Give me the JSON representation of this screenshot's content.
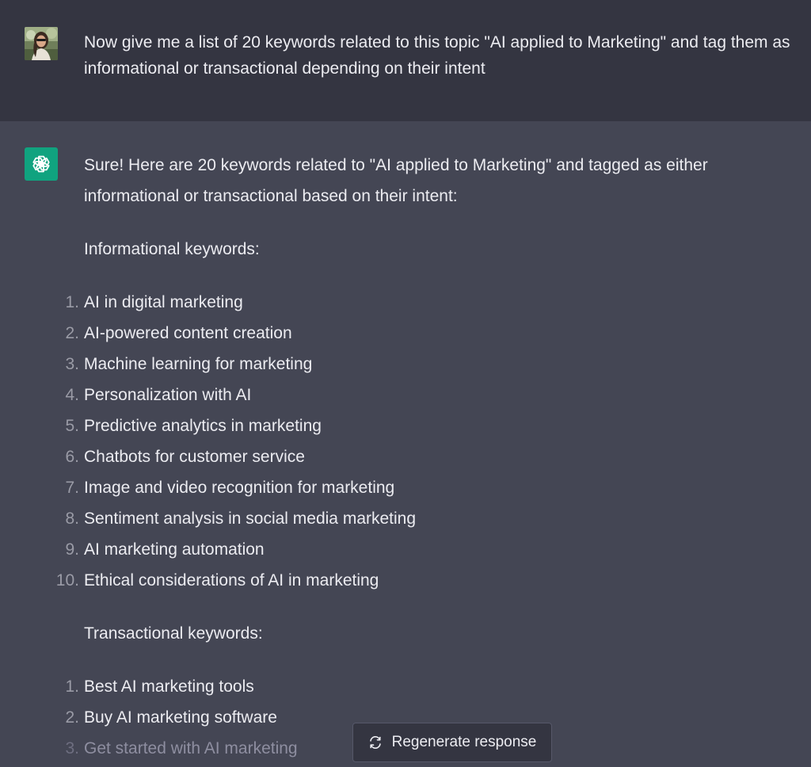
{
  "user_message": {
    "avatar_icon": "user-photo-avatar",
    "text": "Now give me a list of 20 keywords related to this topic \"AI applied to Marketing\" and tag them as informational or transactional depending on their intent"
  },
  "assistant_message": {
    "avatar_icon": "openai-logo-icon",
    "avatar_color": "#10a37f",
    "intro": "Sure! Here are 20 keywords related to \"AI applied to Marketing\" and tagged as either informational or transactional based on their intent:",
    "informational": {
      "heading": "Informational keywords:",
      "items": [
        {
          "num": "1.",
          "text": "AI in digital marketing"
        },
        {
          "num": "2.",
          "text": "AI-powered content creation"
        },
        {
          "num": "3.",
          "text": "Machine learning for marketing"
        },
        {
          "num": "4.",
          "text": "Personalization with AI"
        },
        {
          "num": "5.",
          "text": "Predictive analytics in marketing"
        },
        {
          "num": "6.",
          "text": "Chatbots for customer service"
        },
        {
          "num": "7.",
          "text": "Image and video recognition for marketing"
        },
        {
          "num": "8.",
          "text": "Sentiment analysis in social media marketing"
        },
        {
          "num": "9.",
          "text": "AI marketing automation"
        },
        {
          "num": "10.",
          "text": "Ethical considerations of AI in marketing"
        }
      ]
    },
    "transactional": {
      "heading": "Transactional keywords:",
      "items": [
        {
          "num": "1.",
          "text": "Best AI marketing tools"
        },
        {
          "num": "2.",
          "text": "Buy AI marketing software"
        },
        {
          "num": "3.",
          "text": "Get started with AI marketing"
        }
      ]
    }
  },
  "regenerate_button": {
    "icon": "refresh-icon",
    "label": "Regenerate response"
  },
  "colors": {
    "user_bg": "#343541",
    "assistant_bg": "#444654",
    "accent": "#10a37f"
  }
}
